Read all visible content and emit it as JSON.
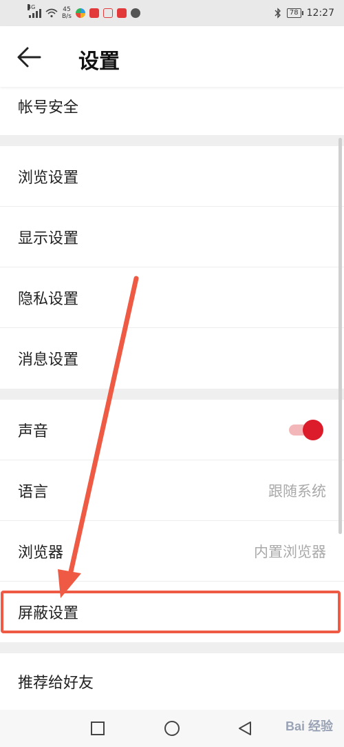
{
  "status_bar": {
    "network_tag": "4G",
    "speed_value": "45",
    "speed_unit": "B/s",
    "battery": "78",
    "time": "12:27"
  },
  "header": {
    "title": "设置",
    "back_icon": "arrow-left-icon"
  },
  "settings": {
    "account_security": "帐号安全",
    "browse_settings": "浏览设置",
    "display_settings": "显示设置",
    "privacy_settings": "隐私设置",
    "message_settings": "消息设置",
    "sound": {
      "label": "声音",
      "enabled": true
    },
    "language": {
      "label": "语言",
      "value": "跟随系统"
    },
    "browser": {
      "label": "浏览器",
      "value": "内置浏览器"
    },
    "block_settings": "屏蔽设置",
    "recommend": "推荐给好友"
  },
  "colors": {
    "accent": "#dc1c2b",
    "annotation": "#ee5a44",
    "gap": "#efefef"
  },
  "nav_bar": {
    "icons": [
      "square-icon",
      "circle-icon",
      "triangle-back-icon"
    ],
    "watermark": "Bai 经验"
  }
}
